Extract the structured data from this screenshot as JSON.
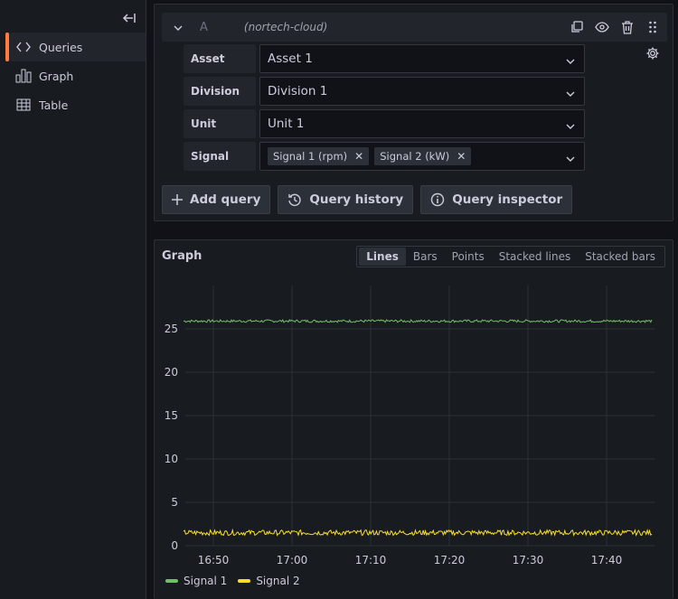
{
  "sidebar": {
    "collapse_icon": "collapse-left-icon",
    "items": [
      {
        "label": "Queries",
        "icon": "code-icon",
        "active": true
      },
      {
        "label": "Graph",
        "icon": "bar-chart-icon",
        "active": false
      },
      {
        "label": "Table",
        "icon": "table-icon",
        "active": false
      }
    ]
  },
  "query": {
    "letter": "A",
    "datasource": "(nortech-cloud)",
    "fields": [
      {
        "label": "Asset",
        "value": "Asset 1"
      },
      {
        "label": "Division",
        "value": "Division 1"
      },
      {
        "label": "Unit",
        "value": "Unit 1"
      },
      {
        "label": "Signal",
        "tags": [
          "Signal 1 (rpm)",
          "Signal 2 (kW)"
        ]
      }
    ],
    "actions": {
      "add": "Add query",
      "history": "Query history",
      "inspector": "Query inspector"
    }
  },
  "graph": {
    "title": "Graph",
    "modes": [
      "Lines",
      "Bars",
      "Points",
      "Stacked lines",
      "Stacked bars"
    ],
    "active_mode": "Lines"
  },
  "colors": {
    "signal1": "#73bf69",
    "signal2": "#fade2a",
    "accent": "#ff7a3c"
  },
  "chart_data": {
    "type": "line",
    "x_ticks": [
      "16:50",
      "17:00",
      "17:10",
      "17:20",
      "17:30",
      "17:40"
    ],
    "y_ticks": [
      0,
      5,
      10,
      15,
      20,
      25
    ],
    "ylim": [
      0,
      30
    ],
    "series": [
      {
        "name": "Signal 1",
        "mean": 25.9,
        "noise": 0.15
      },
      {
        "name": "Signal 2",
        "mean": 1.5,
        "noise": 0.3
      }
    ]
  }
}
